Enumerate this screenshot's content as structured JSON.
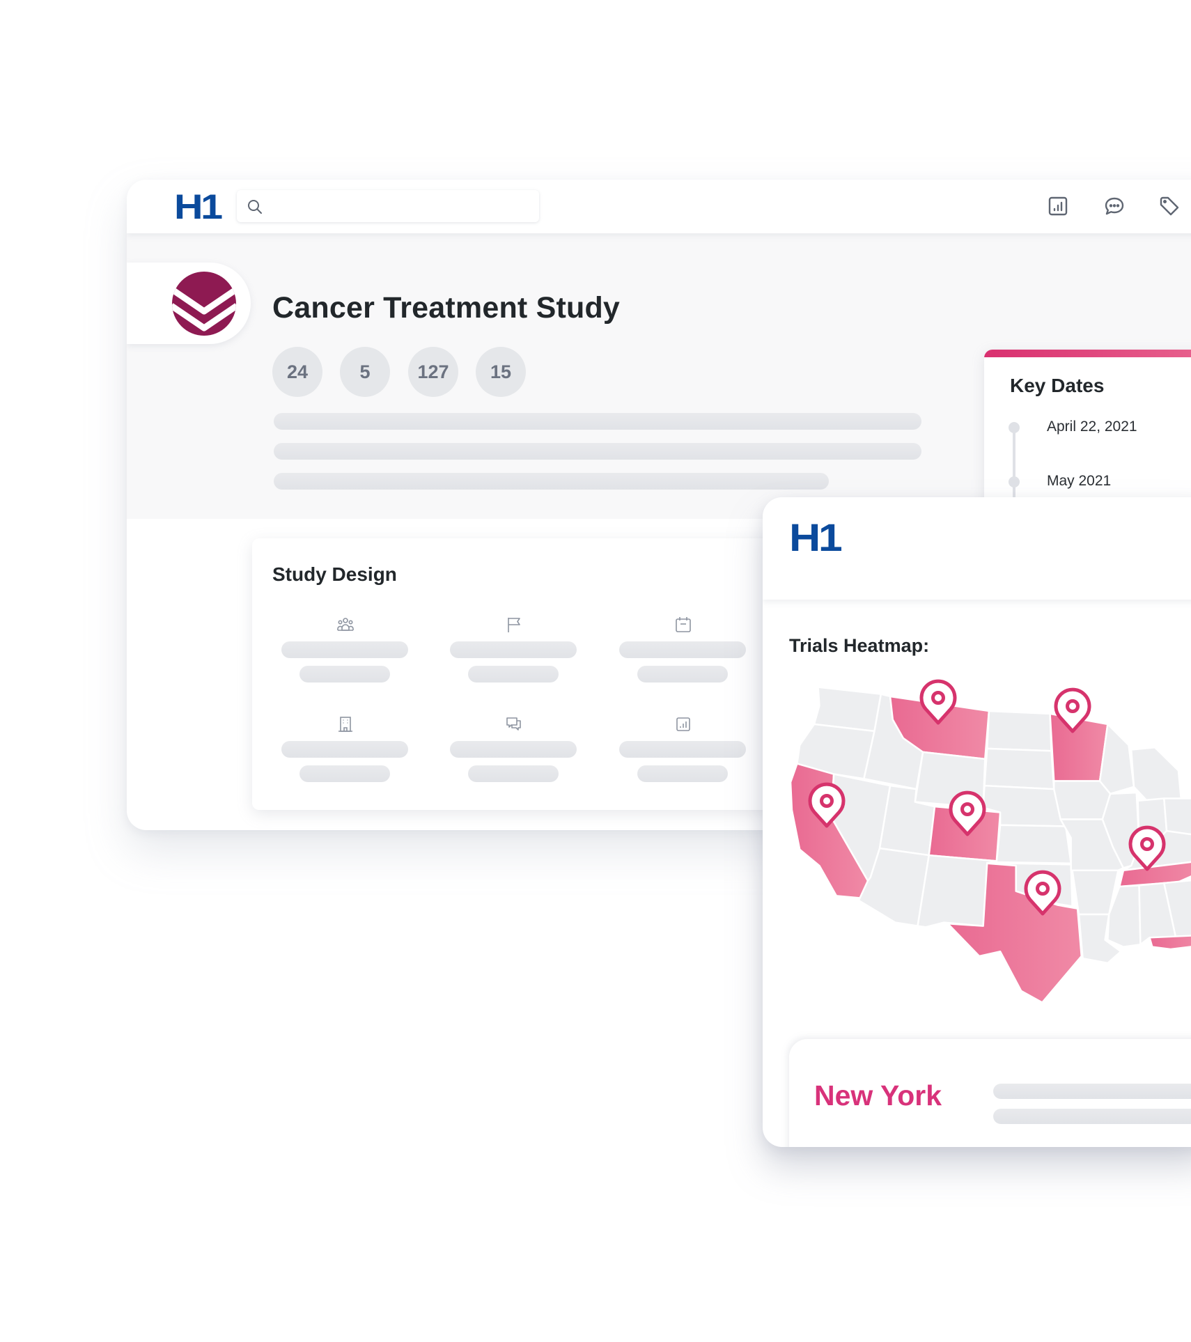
{
  "app": {
    "brand_logo": "H1",
    "search": {
      "placeholder": "",
      "icon": "search-icon"
    },
    "toolbar_icons": [
      "bar-chart-icon",
      "chat-bubble-icon",
      "tag-icon"
    ]
  },
  "study": {
    "title": "Cancer Treatment Study",
    "logo_icon": "study-chevron-logo",
    "stats": [
      "24",
      "5",
      "127",
      "15"
    ],
    "description_skeleton_lines": 3
  },
  "study_design": {
    "title": "Study Design",
    "items": [
      {
        "icon": "people-group-icon"
      },
      {
        "icon": "flag-icon"
      },
      {
        "icon": "calendar-icon"
      },
      {
        "icon": "building-icon"
      },
      {
        "icon": "chat-bubbles-icon"
      },
      {
        "icon": "bar-chart-icon"
      }
    ]
  },
  "key_dates": {
    "title": "Key Dates",
    "dates": [
      "April 22, 2021",
      "May 2021"
    ],
    "accent_color": "#d9306f"
  },
  "heatmap": {
    "brand_logo": "H1",
    "title": "Trials Heatmap:",
    "highlight_color": "#e96a92",
    "base_color": "#edeef0",
    "pin_color": "#d6336c",
    "highlighted_states": [
      "California",
      "Montana",
      "Colorado",
      "Minnesota",
      "Texas",
      "Tennessee",
      "Florida"
    ],
    "pinned_states": [
      "Montana",
      "Minnesota",
      "California",
      "Colorado",
      "Texas",
      "Tennessee"
    ],
    "selected_location": {
      "name": "New York",
      "color": "#d8327a"
    }
  }
}
